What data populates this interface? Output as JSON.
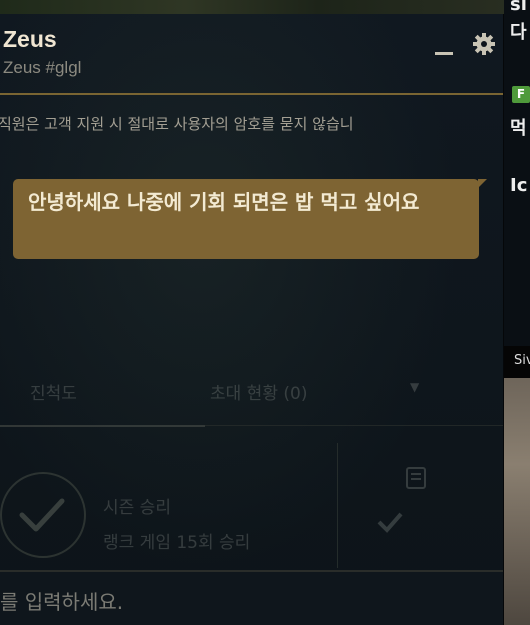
{
  "chat": {
    "title": "Zeus",
    "subtitle": "Zeus #glgl",
    "notice": "직원은 고객 지원 시 절대로 사용자의 암호를 묻지 않습니",
    "message": "안녕하세요 나중에 기회 되면은 밥 먹고 싶어요",
    "input_placeholder": "를 입력하세요."
  },
  "profile_background": {
    "tab_progress": "진척도",
    "tab_invites": "초대 현황 (0)",
    "season_win_title": "시즌 승리",
    "season_win_desc": "랭크 게임 15회 승리"
  },
  "right_panel": {
    "text_top": "si",
    "text_2": "다",
    "badge": "F",
    "text_3": "먹",
    "text_4": "Ic",
    "photo_label": "Siv"
  },
  "colors": {
    "accent_gold": "#7e6433",
    "title_text": "#f0e6d2",
    "badge_green": "#4f9a3b"
  }
}
